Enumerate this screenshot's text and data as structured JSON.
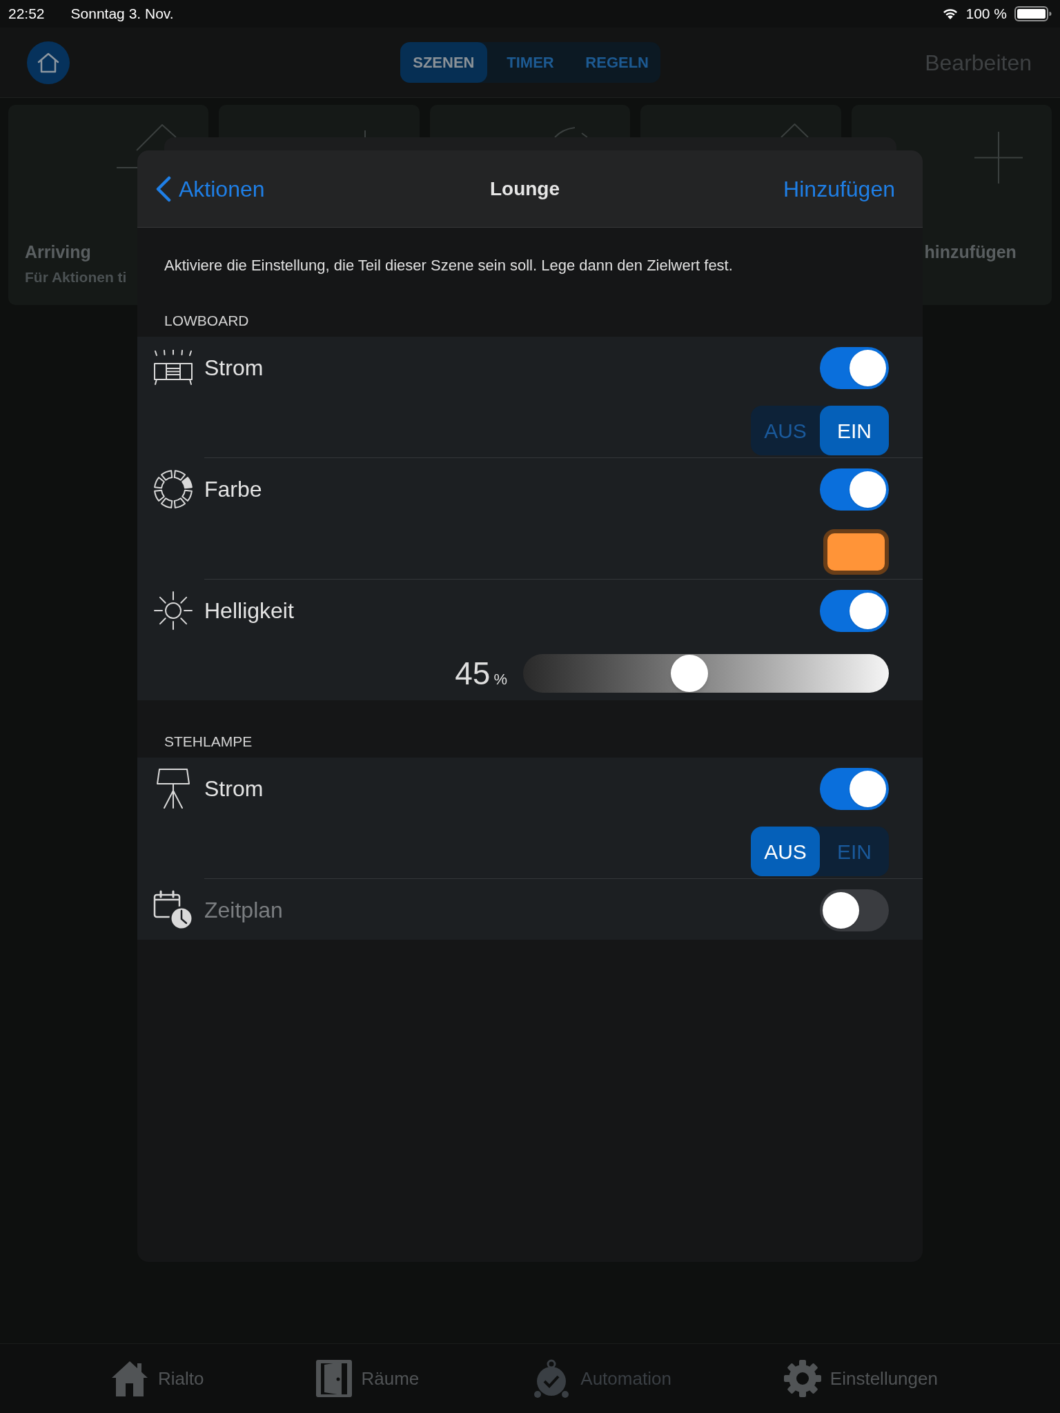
{
  "status_bar": {
    "time": "22:52",
    "date": "Sonntag 3. Nov.",
    "battery": "100 %"
  },
  "header": {
    "tabs": [
      {
        "label": "SZENEN",
        "selected": true
      },
      {
        "label": "TIMER",
        "selected": false
      },
      {
        "label": "REGELN",
        "selected": false
      }
    ],
    "edit_button": "Bearbeiten"
  },
  "scene_tiles": [
    {
      "kind": "scene",
      "title": "Arriving",
      "subtitle": "Für Aktionen ti"
    },
    {
      "kind": "scene"
    },
    {
      "kind": "scene"
    },
    {
      "kind": "scene"
    },
    {
      "kind": "add",
      "title": "hinzufügen"
    }
  ],
  "dialog": {
    "back_button": "Aktionen",
    "title": "Lounge",
    "action_button": "Hinzufügen",
    "hint": "Aktiviere die Einstellung, die Teil dieser Szene sein soll. Lege dann den Zielwert fest.",
    "sections": [
      {
        "title": "LOWBOARD",
        "items": [
          {
            "kind": "switch",
            "label": "Strom",
            "on": true,
            "options": [
              {
                "label": "AUS",
                "selected": false
              },
              {
                "label": "EIN",
                "selected": true
              }
            ]
          },
          {
            "kind": "color",
            "label": "Farbe",
            "on": true,
            "color": "#ff9438"
          },
          {
            "kind": "slider",
            "label": "Helligkeit",
            "on": true,
            "level": 0.45,
            "value": "45",
            "unit": "%"
          }
        ]
      },
      {
        "title": "STEHLAMPE",
        "items": [
          {
            "kind": "switch",
            "label": "Strom",
            "on": true,
            "options": [
              {
                "label": "AUS",
                "selected": true
              },
              {
                "label": "EIN",
                "selected": false
              }
            ]
          },
          {
            "kind": "plain",
            "label": "Zeitplan",
            "on": false
          }
        ]
      }
    ]
  },
  "tab_bar": [
    {
      "label": "Rialto",
      "selected": false
    },
    {
      "label": "Räume",
      "selected": false
    },
    {
      "label": "Automation",
      "selected": true
    },
    {
      "label": "Einstellungen",
      "selected": false
    }
  ]
}
